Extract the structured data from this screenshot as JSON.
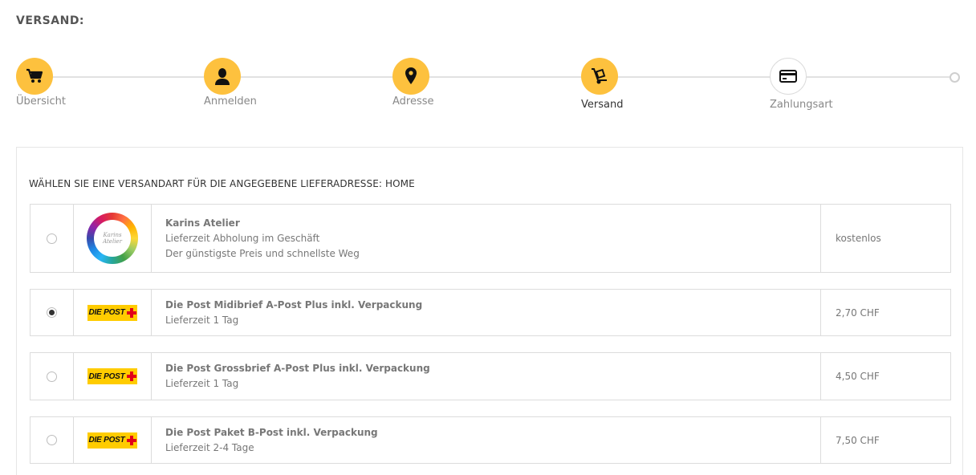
{
  "page": {
    "title": "VERSAND:"
  },
  "steps": [
    {
      "label": "Übersicht",
      "icon": "cart-icon",
      "state": "done"
    },
    {
      "label": "Anmelden",
      "icon": "user-icon",
      "state": "done"
    },
    {
      "label": "Adresse",
      "icon": "map-pin-icon",
      "state": "done"
    },
    {
      "label": "Versand",
      "icon": "hand-truck-icon",
      "state": "current"
    },
    {
      "label": "Zahlungsart",
      "icon": "credit-card-icon",
      "state": "future"
    }
  ],
  "shipping": {
    "section_title": "WÄHLEN SIE EINE VERSANDART FÜR DIE ANGEGEBENE LIEFERADRESSE: HOME",
    "options": [
      {
        "name": "Karins Atelier",
        "lines": [
          "Lieferzeit Abholung im Geschäft",
          "Der günstigste Preis und schnellste Weg"
        ],
        "price": "kostenlos",
        "selected": false,
        "logo": "karins-atelier-logo",
        "logo_text": "Karins Atelier"
      },
      {
        "name": "Die Post Midibrief A-Post Plus inkl. Verpackung",
        "lines": [
          "Lieferzeit 1 Tag"
        ],
        "price": "2,70 CHF",
        "selected": true,
        "logo": "die-post-logo",
        "logo_text": "DIE POST"
      },
      {
        "name": "Die Post Grossbrief A-Post Plus inkl. Verpackung",
        "lines": [
          "Lieferzeit 1 Tag"
        ],
        "price": "4,50 CHF",
        "selected": false,
        "logo": "die-post-logo",
        "logo_text": "DIE POST"
      },
      {
        "name": "Die Post Paket B-Post inkl. Verpackung",
        "lines": [
          "Lieferzeit 2-4 Tage"
        ],
        "price": "7,50 CHF",
        "selected": false,
        "logo": "die-post-logo",
        "logo_text": "DIE POST"
      }
    ]
  },
  "colors": {
    "accent": "#fdc13e",
    "post_yellow": "#ffcc00",
    "post_red": "#e2001a"
  }
}
